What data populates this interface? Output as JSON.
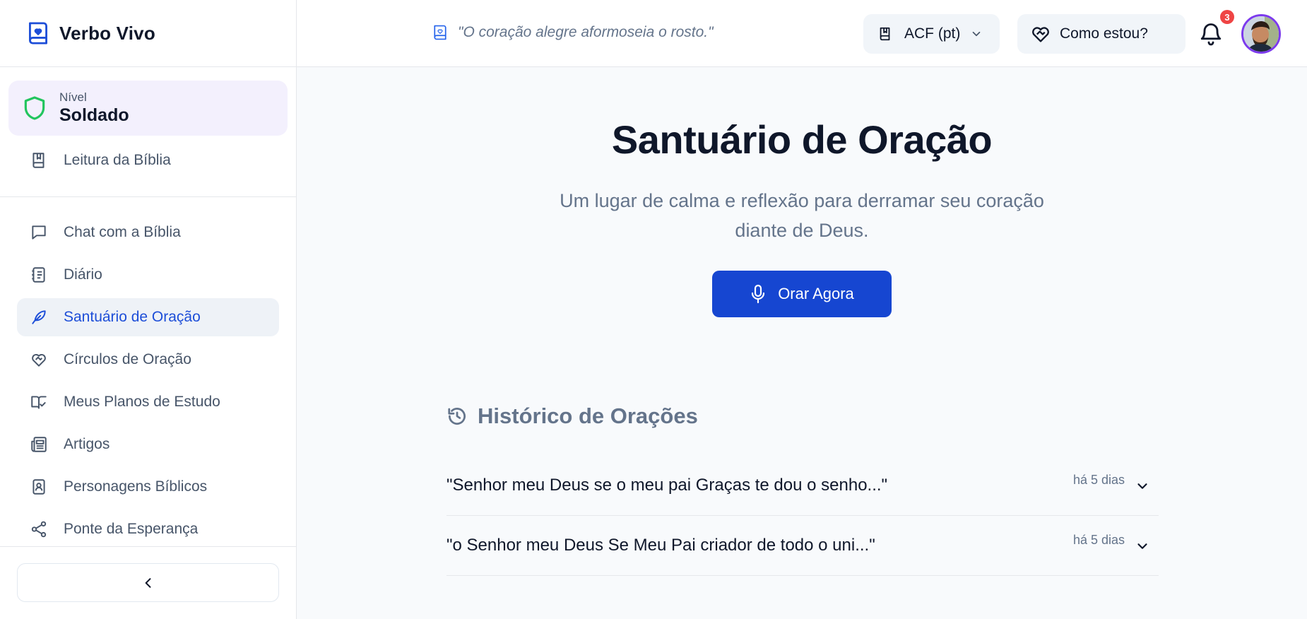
{
  "app": {
    "name": "Verbo Vivo"
  },
  "sidebar": {
    "level": {
      "label": "Nível",
      "value": "Soldado"
    },
    "top_item": {
      "label": "Leitura da Bíblia",
      "icon": "book-icon"
    },
    "items": [
      {
        "label": "Chat com a Bíblia",
        "icon": "chat-icon",
        "active": false
      },
      {
        "label": "Diário",
        "icon": "notebook-icon",
        "active": false
      },
      {
        "label": "Santuário de Oração",
        "icon": "feather-icon",
        "active": true
      },
      {
        "label": "Círculos de Oração",
        "icon": "heart-handshake-icon",
        "active": false
      },
      {
        "label": "Meus Planos de Estudo",
        "icon": "book-check-icon",
        "active": false
      },
      {
        "label": "Artigos",
        "icon": "newspaper-icon",
        "active": false
      },
      {
        "label": "Personagens Bíblicos",
        "icon": "contact-book-icon",
        "active": false
      },
      {
        "label": "Ponte da Esperança",
        "icon": "share-icon",
        "active": false
      }
    ],
    "collapse_icon": "chevron-left-icon"
  },
  "header": {
    "verse": "\"O coração alegre aformoseia o rosto.\"",
    "version": "ACF (pt)",
    "mood_button": "Como estou?",
    "notifications_count": "3"
  },
  "main": {
    "title": "Santuário de Oração",
    "subtitle": "Um lugar de calma e reflexão para derramar seu coração diante de Deus.",
    "pray_button": "Orar Agora",
    "history": {
      "title": "Histórico de Orações",
      "items": [
        {
          "text": "\"Senhor meu Deus se o meu pai Graças te dou o senho...\"",
          "time": "há 5 dias"
        },
        {
          "text": "\"o Senhor meu Deus Se Meu Pai criador de todo o uni...\"",
          "time": "há 5 dias"
        }
      ]
    }
  },
  "colors": {
    "accent": "#1646d1",
    "active_text": "#1d4ed8",
    "level_bg": "#f3f0fd",
    "shield": "#22c55e",
    "badge": "#ef4444",
    "avatar_ring": "#7c3aed"
  }
}
